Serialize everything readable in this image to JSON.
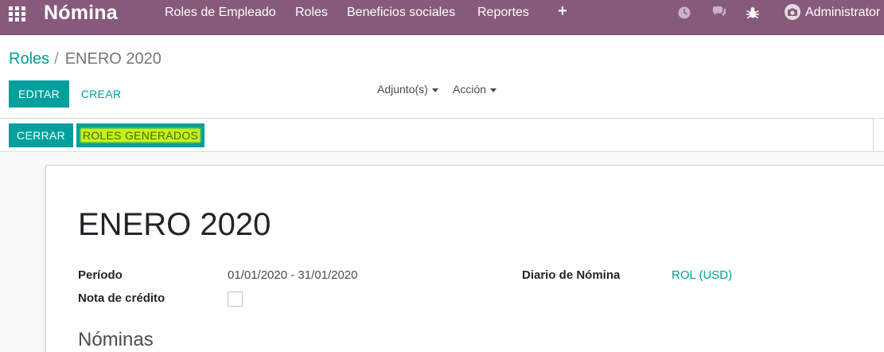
{
  "navbar": {
    "brand": "Nómina",
    "menu": [
      "Roles de Empleado",
      "Roles",
      "Beneficios sociales",
      "Reportes"
    ],
    "plus_icon": "plus-icon",
    "system_icons": [
      "clock-icon",
      "chat-icon",
      "bug-icon"
    ],
    "user": "Administrator",
    "color": "#875a7b"
  },
  "breadcrumb": {
    "parent": "Roles",
    "separator": "/",
    "current": "ENERO 2020"
  },
  "actions": {
    "edit": "EDITAR",
    "create": "CREAR",
    "attachments": "Adjunto(s)",
    "action": "Acción"
  },
  "statusbar": {
    "close": "CERRAR",
    "generated": "ROLES GENERADOS"
  },
  "form": {
    "title": "ENERO 2020",
    "period_label": "Período",
    "period_value": "01/01/2020 - 31/01/2020",
    "credit_note_label": "Nota de crédito",
    "credit_note_checked": false,
    "journal_label": "Diario de Nómina",
    "journal_value": "ROL (USD)",
    "section_title": "Nóminas"
  },
  "colors": {
    "accent": "#00a09d",
    "highlight": "#c4f21c"
  }
}
